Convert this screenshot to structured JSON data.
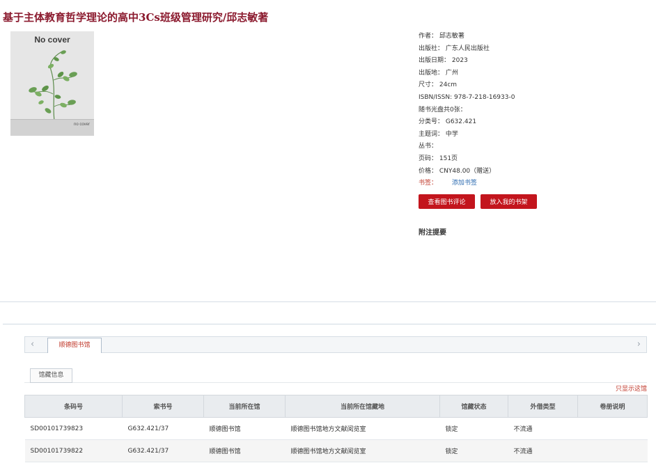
{
  "book": {
    "title": "基于主体教育哲学理论的高中3Cs班级管理研究/邱志敏著",
    "cover": {
      "title": "No cover",
      "small": "no cover"
    }
  },
  "meta": {
    "author": "作者： 邱志敏著",
    "publisher": "出版社： 广东人民出版社",
    "pub_date": "出版日期： 2023",
    "pub_place": "出版地： 广州",
    "size": "尺寸： 24cm",
    "isbn": "ISBN/ISSN:  978-7-218-16933-0",
    "disc": "随书光盘共0张：",
    "class_no": "分类号： G632.421",
    "subject": "主题词： 中学",
    "series": "丛书：",
    "pages": "页码： 151页",
    "price": "价格： CNY48.00（赠送）",
    "bookmark_label": "书签：",
    "bookmark_link": "添加书签"
  },
  "buttons": {
    "review": "查看图书评论",
    "shelf": "放入我的书架"
  },
  "notes_title": "附注提要",
  "holdings": {
    "library_tab": "顺德图书馆",
    "sub_tab": "馆藏信息",
    "show_library_link": "只显示这馆",
    "arrow_left": "‹",
    "arrow_right": "›",
    "columns": [
      "条码号",
      "索书号",
      "当前所在馆",
      "当前所在馆藏地",
      "馆藏状态",
      "外借类型",
      "卷册说明"
    ],
    "rows": [
      [
        "SD00101739823",
        "G632.421/37",
        "顺德图书馆",
        "顺德图书馆地方文献阅览室",
        "锁定",
        "不流通",
        ""
      ],
      [
        "SD00101739822",
        "G632.421/37",
        "顺德图书馆",
        "顺德图书馆地方文献阅览室",
        "锁定",
        "不流通",
        ""
      ]
    ]
  }
}
